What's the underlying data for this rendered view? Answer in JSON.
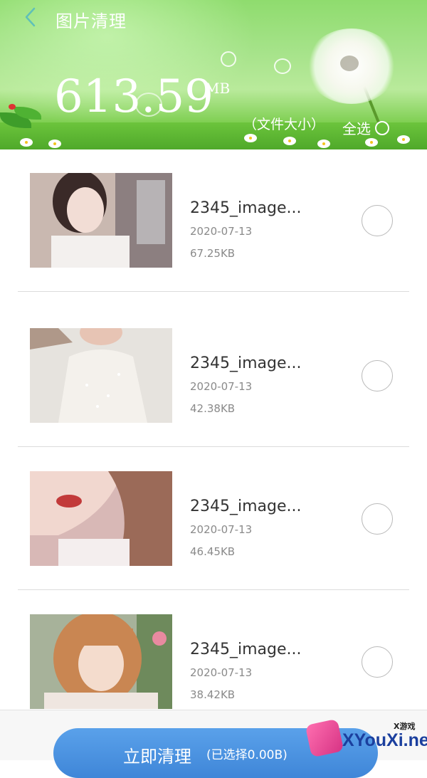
{
  "header": {
    "title": "图片清理",
    "total_size": "613.59",
    "total_unit": "MB",
    "size_caption": "（文件大小）",
    "select_all_label": "全选"
  },
  "items": [
    {
      "name": "2345_image...",
      "date": "2020-07-13",
      "size": "67.25KB"
    },
    {
      "name": "2345_image...",
      "date": "2020-07-13",
      "size": "42.38KB"
    },
    {
      "name": "2345_image...",
      "date": "2020-07-13",
      "size": "46.45KB"
    },
    {
      "name": "2345_image...",
      "date": "2020-07-13",
      "size": "38.42KB"
    }
  ],
  "footer": {
    "clean_label": "立即清理",
    "clean_selected": "(已选择0.00B)"
  },
  "watermark": {
    "small": "X游戏",
    "main": "XYouXi.net"
  },
  "colors": {
    "accent": "#4a90e2",
    "header_green": "#8fdc6e",
    "back_arrow": "#5fc0b8"
  }
}
